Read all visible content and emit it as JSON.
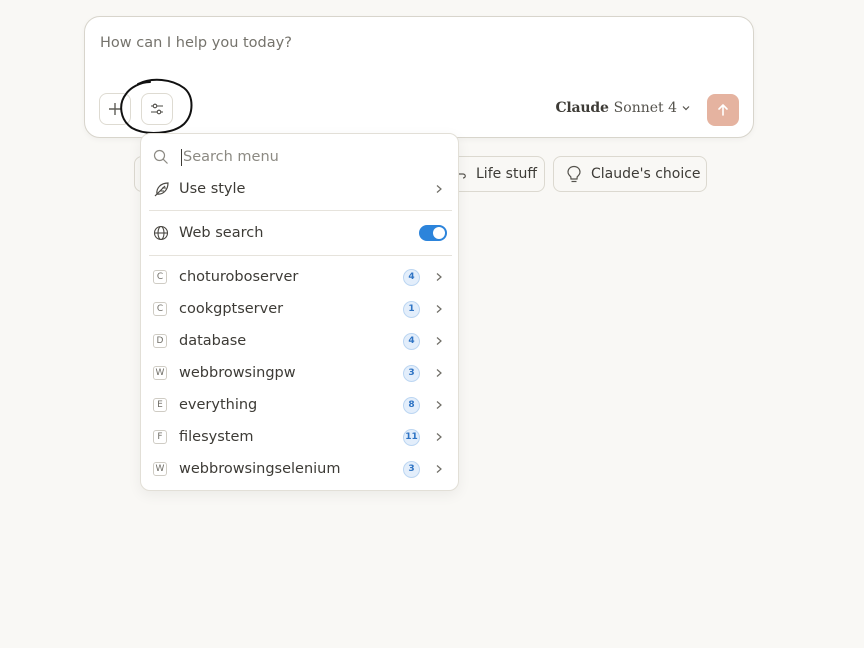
{
  "composer": {
    "placeholder": "How can I help you today?",
    "model_brand": "Claude",
    "model_version": "Sonnet 4"
  },
  "chips": [
    {
      "label": "Life stuff",
      "icon": "coffee-icon"
    },
    {
      "label": "Claude's choice",
      "icon": "lightbulb-icon"
    }
  ],
  "menu": {
    "search_placeholder": "Search menu",
    "use_style": "Use style",
    "web_search": "Web search",
    "web_search_enabled": true,
    "servers": [
      {
        "letter": "C",
        "name": "choturoboserver",
        "count": "4"
      },
      {
        "letter": "C",
        "name": "cookgptserver",
        "count": "1"
      },
      {
        "letter": "D",
        "name": "database",
        "count": "4"
      },
      {
        "letter": "W",
        "name": "webbrowsingpw",
        "count": "3"
      },
      {
        "letter": "E",
        "name": "everything",
        "count": "8"
      },
      {
        "letter": "F",
        "name": "filesystem",
        "count": "11"
      },
      {
        "letter": "W",
        "name": "webbrowsingselenium",
        "count": "3"
      }
    ]
  },
  "colors": {
    "background": "#f9f8f5",
    "send_button": "#e5b3a0",
    "toggle_on": "#2c84db",
    "badge_text": "#2f74c4"
  }
}
